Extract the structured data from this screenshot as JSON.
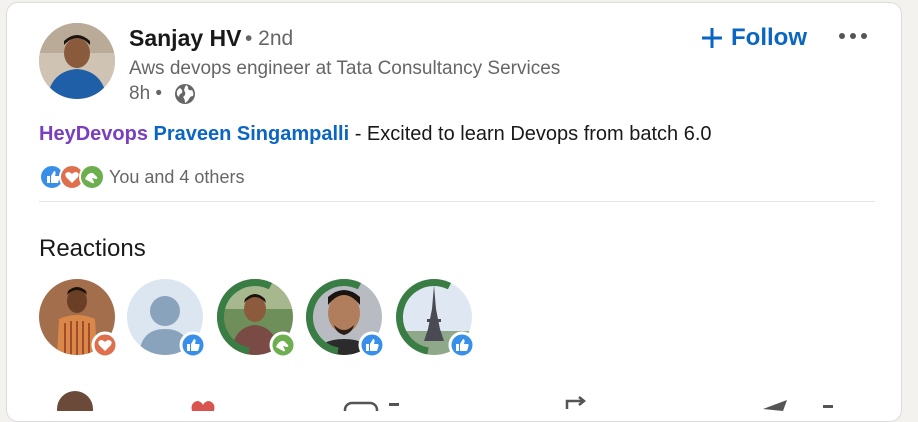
{
  "post": {
    "author_name": "Sanjay HV",
    "degree": "• 2nd",
    "headline": "Aws devops engineer at Tata Consultancy Services",
    "time": "8h •",
    "follow_label": "Follow",
    "text_hashtag": "HeyDevops",
    "text_mention": "Praveen Singampalli",
    "text_body": " - Excited to learn Devops from batch 6.0",
    "reaction_summary": "You and 4 others"
  },
  "reactions": {
    "heading": "Reactions",
    "people": [
      {
        "badge": "love"
      },
      {
        "badge": "like"
      },
      {
        "badge": "support",
        "frame": "opentowork"
      },
      {
        "badge": "like",
        "frame": "opentowork"
      },
      {
        "badge": "like",
        "frame": "opentowork"
      }
    ]
  },
  "colors": {
    "link_blue": "#0a66c2",
    "hashtag_purple": "#7a3fc1",
    "like_blue": "#378fe9",
    "love_red": "#df704d",
    "support_green": "#6dae4f",
    "opentowork_green": "#3a7d44"
  },
  "icons": [
    "globe-icon",
    "plus-icon",
    "more-icon",
    "like-icon",
    "love-icon",
    "support-icon"
  ]
}
